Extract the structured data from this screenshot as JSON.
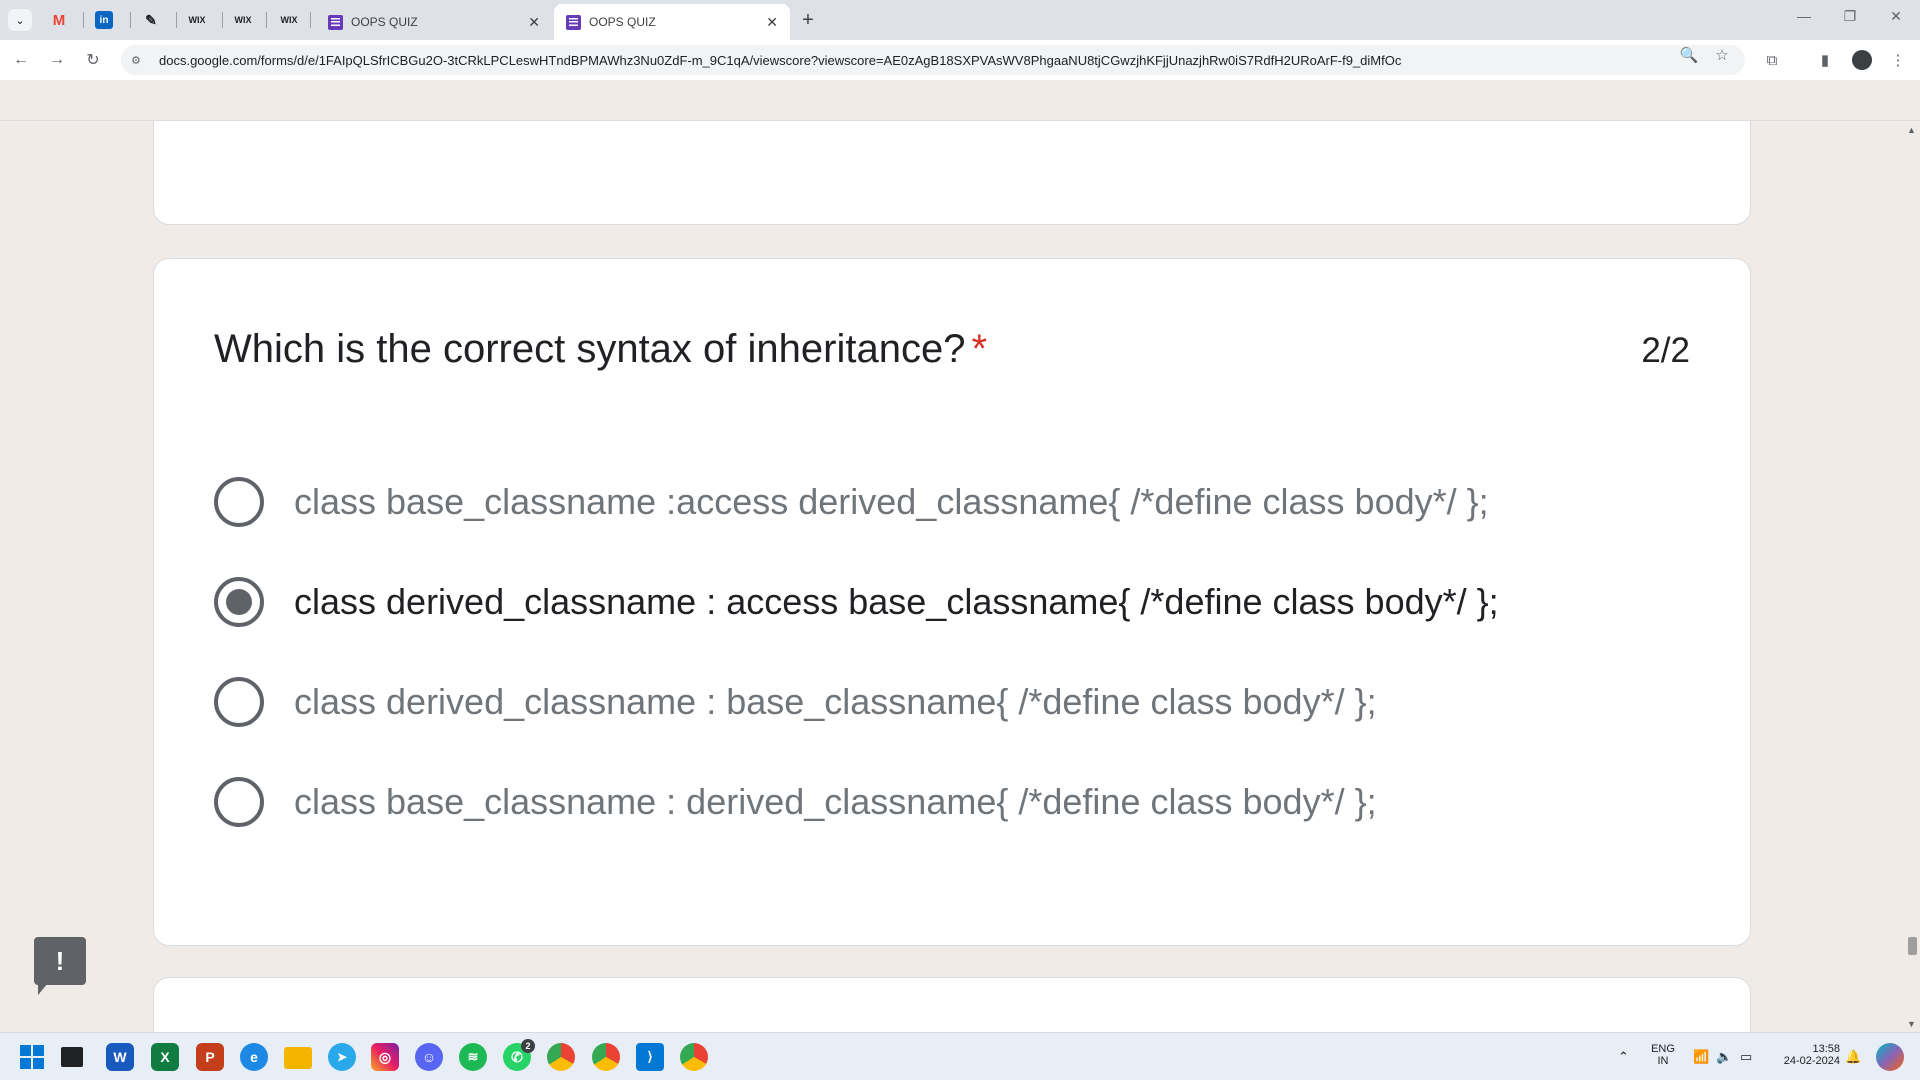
{
  "browser": {
    "tabs": [
      {
        "title": "OOPS QUIZ",
        "active": false
      },
      {
        "title": "OOPS QUIZ",
        "active": true
      }
    ],
    "pinned_tabs": [
      "gmail-icon",
      "linkedin-icon",
      "pen-icon",
      "wix-icon",
      "wix-icon",
      "wix-icon"
    ],
    "pinned_labels": {
      "gmail": "M",
      "linkedin": "in",
      "pen": "✎",
      "wix1": "WIX",
      "wix2": "WIX",
      "wix3": "WIX"
    },
    "url": "docs.google.com/forms/d/e/1FAIpQLSfrICBGu2O-3tCRkLPCLeswHTndBPMAWhz3Nu0ZdF-m_9C1qA/viewscore?viewscore=AE0zAgB18SXPVAsWV8PhgaaNU8tjCGwzjhKFjjUnazjhRw0iS7RdfH2URoArF-f9_diMfOc"
  },
  "question": {
    "title": "Which is the correct syntax of inheritance?",
    "required_mark": "*",
    "points": "2/2",
    "options": [
      {
        "text": "class base_classname :access derived_classname{ /*define class body*/ };",
        "selected": false
      },
      {
        "text": "class derived_classname : access base_classname{ /*define class body*/ };",
        "selected": true
      },
      {
        "text": "class derived_classname : base_classname{ /*define class body*/ };",
        "selected": false
      },
      {
        "text": "class base_classname : derived_classname{ /*define class body*/ };",
        "selected": false
      }
    ]
  },
  "feedback_button": {
    "label": "!"
  },
  "taskbar": {
    "apps": [
      "start-icon",
      "file-explorer-window-icon",
      "word-icon",
      "excel-icon",
      "powerpoint-icon",
      "edge-icon",
      "folder-icon",
      "telegram-icon",
      "instagram-icon",
      "discord-icon",
      "spotify-icon",
      "whatsapp-icon",
      "chrome-icon",
      "chrome-profile-icon",
      "vscode-icon",
      "chrome-profile2-icon"
    ],
    "app_labels": {
      "word": "W",
      "excel": "X",
      "powerpoint": "P",
      "edge": "e"
    },
    "whatsapp_badge": "2",
    "language_line1": "ENG",
    "language_line2": "IN",
    "time": "13:58",
    "date": "24-02-2024"
  },
  "colors": {
    "accent": "#673ab7",
    "required": "#d93025",
    "radio": "#5f6368"
  }
}
